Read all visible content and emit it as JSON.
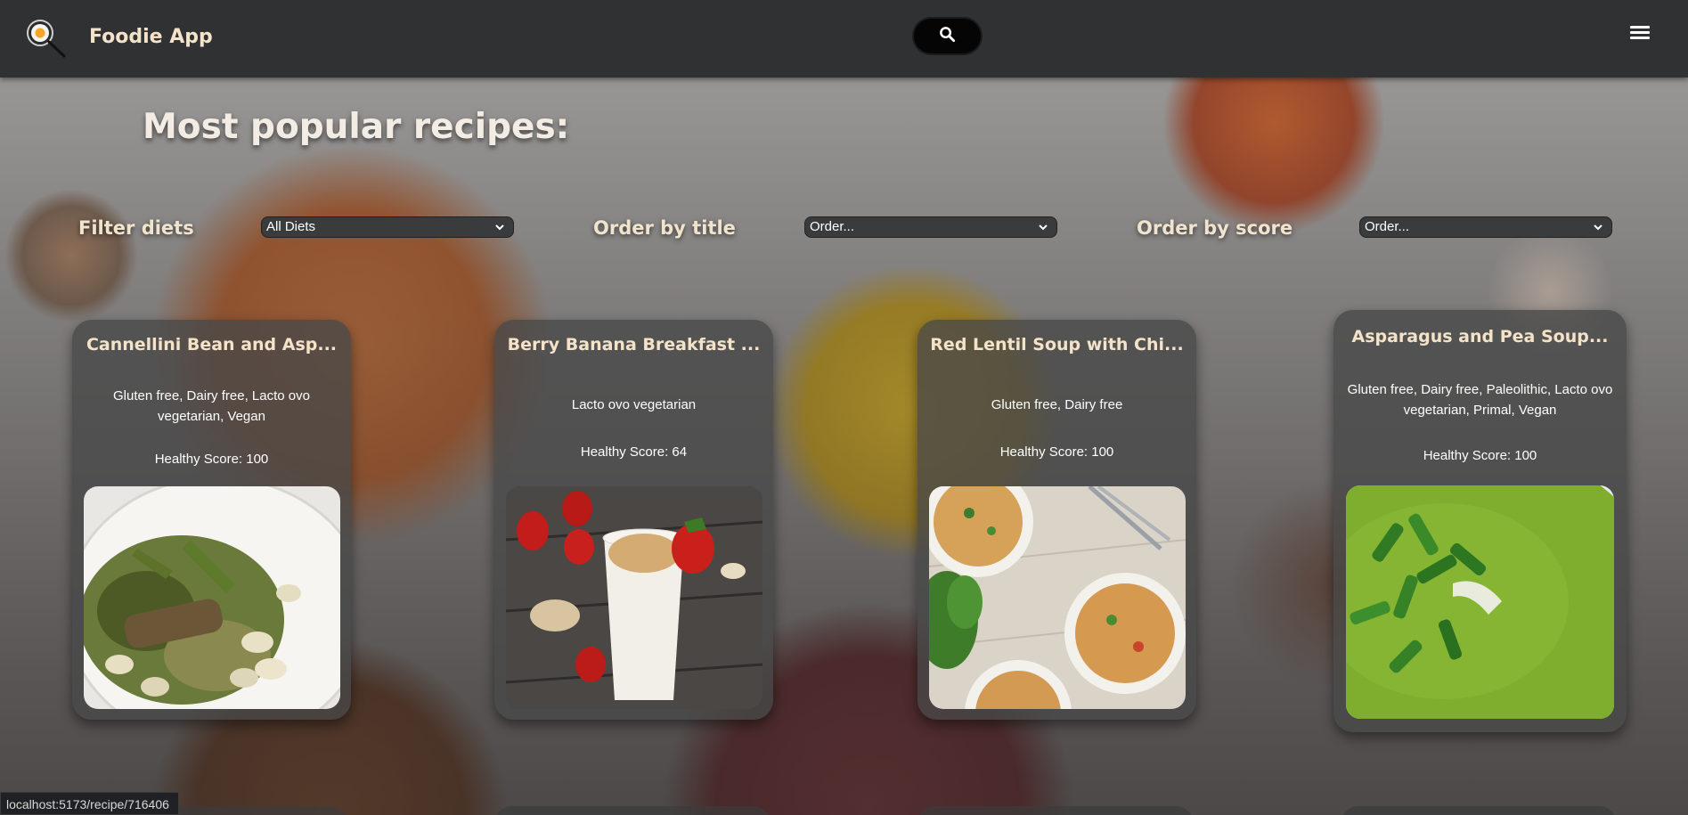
{
  "header": {
    "app_title": "Foodie App",
    "logo_icon": "frying-pan-egg-icon",
    "search_icon": "search-icon",
    "menu_icon": "hamburger-menu-icon"
  },
  "main": {
    "heading": "Most popular recipes:",
    "filters": {
      "diet_label": "Filter diets",
      "diet_value": "All Diets",
      "title_label": "Order by title",
      "title_value": "Order...",
      "score_label": "Order by score",
      "score_value": "Order..."
    },
    "recipes": [
      {
        "title": "Cannellini Bean and Asp...",
        "diets": "Gluten free, Dairy free, Lacto ovo vegetarian, Vegan",
        "score": "Healthy Score: 100",
        "image": "cannellini-bean-asparagus-dish"
      },
      {
        "title": "Berry Banana Breakfast ...",
        "diets": "Lacto ovo vegetarian",
        "score": "Healthy Score: 64",
        "image": "berry-banana-smoothie"
      },
      {
        "title": "Red Lentil Soup with Chi...",
        "diets": "Gluten free, Dairy free",
        "score": "Healthy Score: 100",
        "image": "red-lentil-soup-bowls"
      },
      {
        "title": "Asparagus and Pea Soup...",
        "diets": "Gluten free, Dairy free, Paleolithic, Lacto ovo vegetarian, Primal, Vegan",
        "score": "Healthy Score: 100",
        "image": "green-pea-soup"
      }
    ]
  },
  "status_bar": {
    "url": "localhost:5173/recipe/716406"
  },
  "colors": {
    "header_bg": "#2f3132",
    "accent_text": "#f4e3c8",
    "card_bg": "#484848"
  }
}
